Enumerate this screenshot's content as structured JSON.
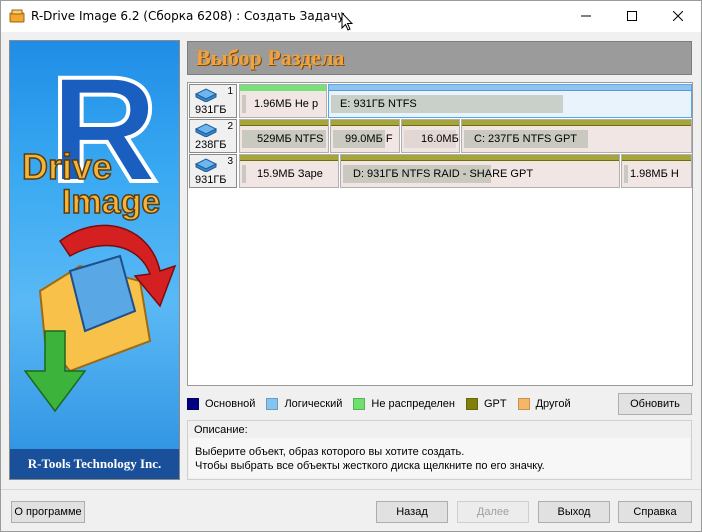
{
  "window": {
    "title": "R-Drive Image 6.2 (Сборка 6208) : Создать Задачу"
  },
  "banner": {
    "logo_text_1": "Drive",
    "logo_text_2": "Image",
    "logo_letter": "R",
    "footer": "R-Tools Technology Inc."
  },
  "header": {
    "title": "Выбор Раздела"
  },
  "disks": [
    {
      "num": "1",
      "size": "931ГБ",
      "partitions": [
        {
          "label": "1.96МБ  Не р"
        },
        {
          "label": "E:  931ГБ  NTFS"
        }
      ]
    },
    {
      "num": "2",
      "size": "238ГБ",
      "partitions": [
        {
          "label": "529МБ  NTFS"
        },
        {
          "label": "99.0МБ  F"
        },
        {
          "label": "16.0МБ"
        },
        {
          "label": "C:  237ГБ  NTFS   GPT"
        }
      ]
    },
    {
      "num": "3",
      "size": "931ГБ",
      "partitions": [
        {
          "label": "15.9МБ     Заре"
        },
        {
          "label": "D:  931ГБ  NTFS  RAID - SHARE GPT"
        },
        {
          "label": "1.98МБ  Н"
        }
      ]
    }
  ],
  "legend": [
    {
      "label": "Основной",
      "color": "#000080"
    },
    {
      "label": "Логический",
      "color": "#87c3f0"
    },
    {
      "label": "Не распределен",
      "color": "#6ee06e"
    },
    {
      "label": "GPT",
      "color": "#80800a"
    },
    {
      "label": "Другой",
      "color": "#f5b766"
    }
  ],
  "buttons": {
    "refresh": "Обновить",
    "about": "О программе",
    "back": "Назад",
    "next": "Далее",
    "exit": "Выход",
    "help": "Справка"
  },
  "description": {
    "title": "Описание:",
    "line1": "Выберите объект, образ которого вы хотите создать.",
    "line2": "Чтобы выбрать все объекты жесткого диска щелкните по его значку."
  }
}
